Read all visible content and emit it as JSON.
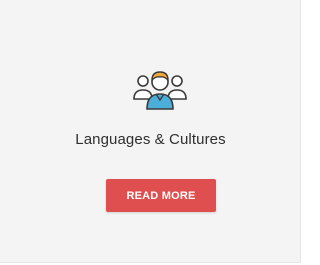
{
  "card": {
    "icon": "people-group-icon",
    "title": "Languages & Cultures",
    "button_label": "READ MORE"
  },
  "colors": {
    "card_background": "#f4f4f4",
    "button": "#e04f4f",
    "icon_outline": "#3a3a3a",
    "icon_shirt": "#4aaed9",
    "icon_hair": "#f2a93b"
  }
}
